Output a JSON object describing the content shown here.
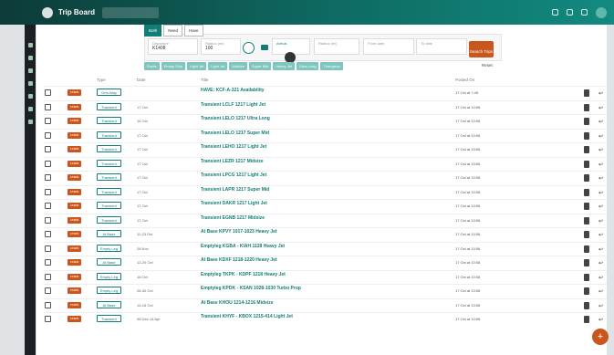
{
  "app": {
    "title": "Trip Board"
  },
  "search_tabs": [
    "Both",
    "Need",
    "Have"
  ],
  "fields": {
    "departure_label": "Departure",
    "departure_value": "K1408",
    "radius_label": "Radius (mi)",
    "radius_value": "100",
    "arrival_label": "Arrival",
    "from_label": "From date",
    "to_label": "To date"
  },
  "search_button": "Search Trips",
  "filters": [
    "Route",
    "Empty Ship",
    "Light Jet",
    "Light Jet",
    "Midsize",
    "Super Mid",
    "Heavy Jet",
    "Ultra Long",
    "Turboprop"
  ],
  "reset": "Reset",
  "columns": {
    "type": "Type",
    "date": "Date",
    "title": "Title",
    "posted": "Posted On"
  },
  "rows": [
    {
      "status": "Leads",
      "type": "One-Way",
      "date": "",
      "title": "HAVE: KCF-A-321 Availability",
      "posted": "17 Oct at 7:45"
    },
    {
      "status": "Leads",
      "type": "Transient",
      "date": "17 Oct",
      "title": "Transient LCLF 1217 Light Jet",
      "posted": "17 Oct at 10:56"
    },
    {
      "status": "Leads",
      "type": "Transient",
      "date": "16 Oct",
      "title": "Transient LELO 1217 Ultra Long",
      "posted": "17 Oct at 10:56"
    },
    {
      "status": "Leads",
      "type": "Transient",
      "date": "17 Oct",
      "title": "Transient LELO 1217 Super Mid",
      "posted": "17 Oct at 10:56"
    },
    {
      "status": "Leads",
      "type": "Transient",
      "date": "17 Oct",
      "title": "Transient LEHO 1217 Light Jet",
      "posted": "17 Oct at 10:56"
    },
    {
      "status": "Leads",
      "type": "Transient",
      "date": "17 Oct",
      "title": "Transient LEZR 1217 Midsize",
      "posted": "17 Oct at 10:56"
    },
    {
      "status": "Leads",
      "type": "Transient",
      "date": "17 Oct",
      "title": "Transient LPCG 1217 Light Jet",
      "posted": "17 Oct at 10:56"
    },
    {
      "status": "Leads",
      "type": "Transient",
      "date": "17 Oct",
      "title": "Transient LAPR 1217 Super Mid",
      "posted": "17 Oct at 10:56"
    },
    {
      "status": "Leads",
      "type": "Transient",
      "date": "17 Oct",
      "title": "Transient DAKR 1217 Light Jet",
      "posted": "17 Oct at 10:56"
    },
    {
      "status": "Leads",
      "type": "Transient",
      "date": "17 Oct",
      "title": "Transient EGNB 1217 Midsize",
      "posted": "17 Oct at 10:56"
    },
    {
      "status": "Leads",
      "type": "At Base",
      "date": "11-23 Oct",
      "title": "At Base KPVY 1017-1023 Heavy Jet",
      "posted": "17 Oct at 10:56"
    },
    {
      "status": "Leads",
      "type": "Empty Leg",
      "date": "28 Nov",
      "title": "Emptyleg KGBA - KIAH 1128 Heavy Jet",
      "posted": "17 Oct at 10:56"
    },
    {
      "status": "Leads",
      "type": "At Base",
      "date": "12-20 Oct",
      "title": "At Base KDXF 1218-1220 Heavy Jet",
      "posted": "17 Oct at 10:56"
    },
    {
      "status": "Leads",
      "type": "Empty Leg",
      "date": "18 Oct",
      "title": "Emptyleg TKPK - KDPF 1218 Heavy Jet",
      "posted": "17 Oct at 10:56"
    },
    {
      "status": "Leads",
      "type": "Empty Leg",
      "date": "28-30 Oct",
      "title": "Emptyleg KPDK - KSAN 1028-1030 Turbo Prop",
      "posted": "17 Oct at 10:56"
    },
    {
      "status": "Leads",
      "type": "At Base",
      "date": "14-16 Oct",
      "title": "At Base KHOU 1214-1216 Midsize",
      "posted": "17 Oct at 10:56"
    },
    {
      "status": "Leads",
      "type": "Transient",
      "date": "08 Dec-14 Apr",
      "title": "Transient KHYF - KBOX 1215-414 Light Jet",
      "posted": "17 Oct at 10:56"
    }
  ]
}
